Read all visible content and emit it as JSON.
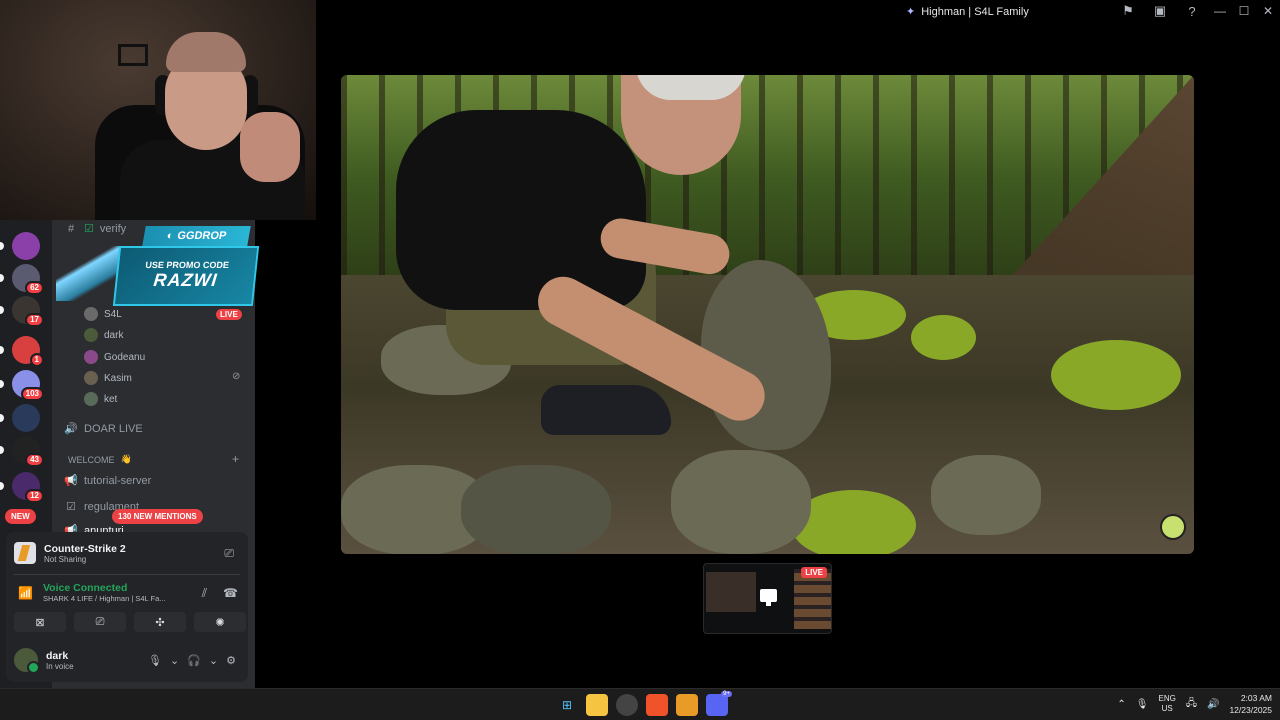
{
  "window": {
    "title": "Highman | S4L Family"
  },
  "stream": {
    "preview_live": "LIVE"
  },
  "guilds": [
    {
      "badge": "62"
    },
    {
      "badge": "17"
    },
    {
      "badge": "1"
    },
    {
      "badge": "103"
    },
    {
      "badge": "43"
    },
    {
      "badge": "12"
    }
  ],
  "channels": {
    "verify": "verify",
    "live_user_label": "S4L",
    "live_badge": "LIVE",
    "voice_users": [
      "dark",
      "Godeanu",
      "Kasim",
      "ket"
    ],
    "doar_live": "DOAR LIVE",
    "welcome_category": "WELCOME",
    "tutorial": "tutorial-server",
    "regulament": "regulament",
    "anunturi": "anunturi"
  },
  "promo": {
    "brand": "GGDROP",
    "line1": "USE PROMO CODE",
    "code": "RAZWI"
  },
  "pills": {
    "new": "NEW",
    "mentions": "130 NEW MENTIONS"
  },
  "activity": {
    "title": "Counter-Strike 2",
    "subtitle": "Not Sharing"
  },
  "voice": {
    "status": "Voice Connected",
    "location": "SHARK 4 LIFE / Highman | S4L Fa..."
  },
  "user": {
    "name": "dark",
    "status": "In voice"
  },
  "tray": {
    "lang_top": "ENG",
    "lang_bottom": "US",
    "time": "2:03 AM",
    "date": "12/23/2025"
  },
  "taskbar": {
    "discord_badge": "9+"
  },
  "colors": {
    "accent_red": "#ed4245",
    "voice_green": "#23a55a",
    "discord_bg": "#2b2d31"
  }
}
